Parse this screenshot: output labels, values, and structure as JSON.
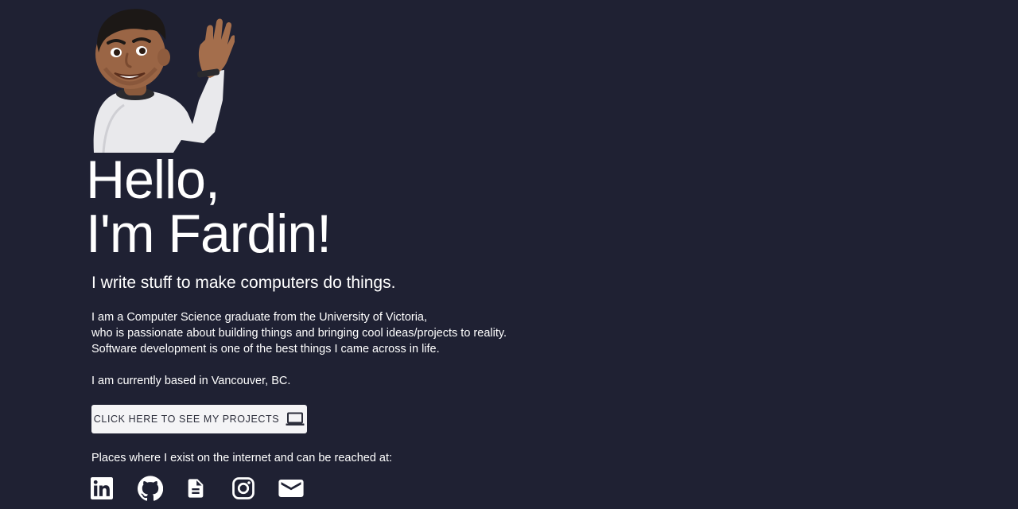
{
  "hero": {
    "greeting_line1": "Hello,",
    "greeting_line2": "I'm Fardin!",
    "tagline": "I write stuff to make computers do things."
  },
  "bio": {
    "line1": "I am a Computer Science graduate from the University of Victoria,",
    "line2": "who is passionate about building things and bringing cool ideas/projects to reality.",
    "line3": "Software development is one of the best things I came across in life.",
    "location": "I am currently based in Vancouver, BC."
  },
  "projects_button": {
    "label": "CLICK HERE TO SEE MY PROJECTS",
    "icon": "laptop-icon"
  },
  "socials": {
    "intro": "Places where I exist on the internet and can be reached at:",
    "items": [
      {
        "icon": "linkedin-icon"
      },
      {
        "icon": "github-icon"
      },
      {
        "icon": "resume-document-icon"
      },
      {
        "icon": "instagram-icon"
      },
      {
        "icon": "email-icon"
      }
    ]
  },
  "colors": {
    "background": "#1f2133",
    "text": "#ffffff",
    "button_bg": "#f4f4f6",
    "button_text": "#2b2d3a"
  }
}
